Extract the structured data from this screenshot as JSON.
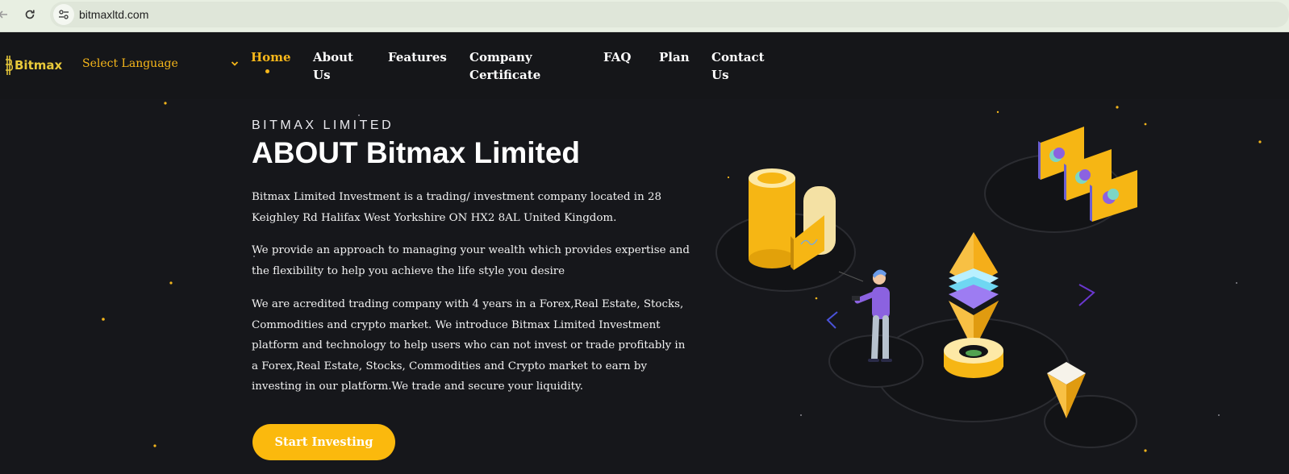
{
  "browser": {
    "url": "bitmaxltd.com"
  },
  "header": {
    "logo_text": "Bitmax",
    "language_label": "Select Language",
    "nav": [
      {
        "label": "Home",
        "active": true
      },
      {
        "label": "About Us",
        "active": false
      },
      {
        "label": "Features",
        "active": false
      },
      {
        "label": "Company Certificate",
        "active": false
      },
      {
        "label": "FAQ",
        "active": false
      },
      {
        "label": "Plan",
        "active": false
      },
      {
        "label": "Contact Us",
        "active": false
      }
    ]
  },
  "hero": {
    "eyebrow": "BITMAX LIMITED",
    "title": "ABOUT Bitmax Limited",
    "paragraphs": [
      "Bitmax Limited Investment is a trading/ investment company located in 28 Keighley Rd Halifax West Yorkshire ON HX2 8AL United Kingdom.",
      "We provide an approach to managing your wealth which provides expertise and the flexibility to help you achieve the life style you desire",
      "We are acredited trading company with 4 years in a Forex,Real Estate, Stocks, Commodities and crypto market. We introduce Bitmax Limited Investment platform and technology to help users who can not invest or trade profitably in a Forex,Real Estate, Stocks, Commodities and Crypto market to earn by investing in our platform.We trade and secure your liquidity."
    ],
    "cta_label": "Start Investing"
  },
  "colors": {
    "accent": "#fbb90d",
    "header_bg": "#151619",
    "page_bg": "#16171b",
    "chrome_bg": "#e8efe2"
  },
  "icons": {
    "back": "arrow-left-icon",
    "reload": "reload-icon",
    "site_info": "tune-icon",
    "language_chevron": "chevron-down-icon"
  }
}
